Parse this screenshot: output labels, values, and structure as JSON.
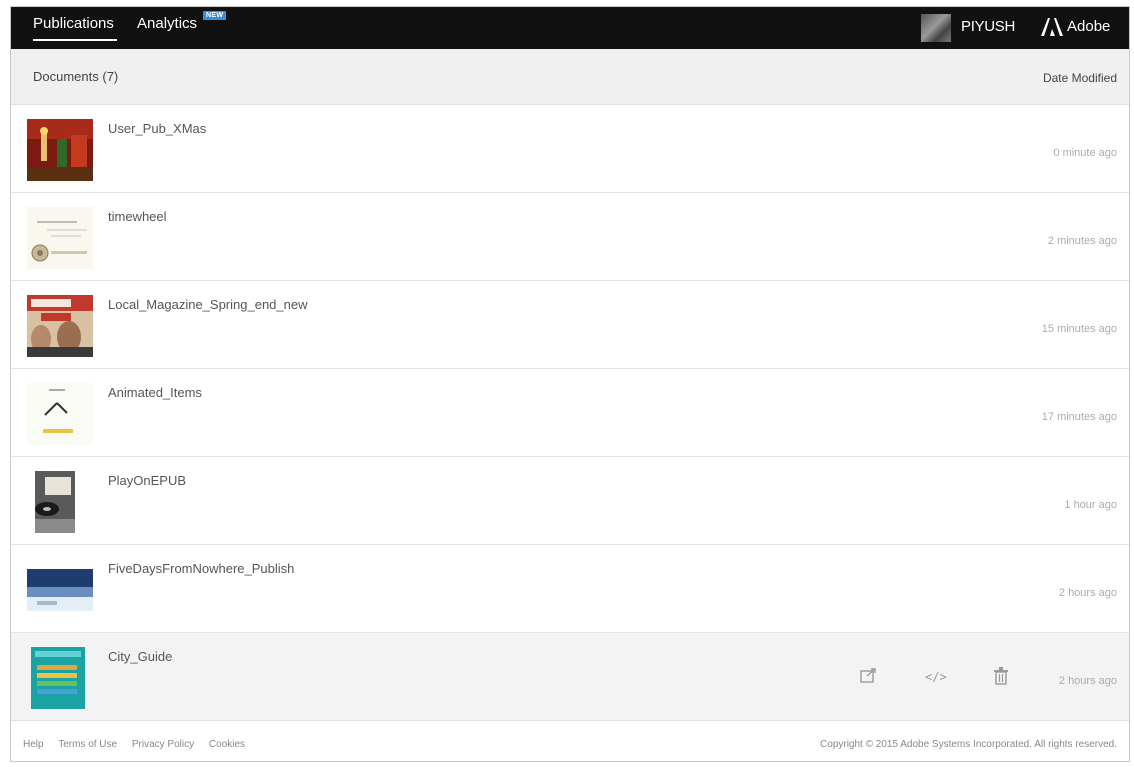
{
  "topbar": {
    "tabs": [
      {
        "label": "Publications"
      },
      {
        "label": "Analytics"
      }
    ],
    "new_badge": "NEW",
    "username": "PIYUSH",
    "brand": "Adobe"
  },
  "list": {
    "title": "Documents (7)",
    "sort_label": "Date Modified",
    "items": [
      {
        "name": "User_Pub_XMas",
        "modified": "0 minute ago"
      },
      {
        "name": "timewheel",
        "modified": "2 minutes ago"
      },
      {
        "name": "Local_Magazine_Spring_end_new",
        "modified": "15 minutes ago"
      },
      {
        "name": "Animated_Items",
        "modified": "17 minutes ago"
      },
      {
        "name": "PlayOnEPUB",
        "modified": "1 hour ago"
      },
      {
        "name": "FiveDaysFromNowhere_Publish",
        "modified": "2 hours ago"
      },
      {
        "name": "City_Guide",
        "modified": "2 hours ago"
      }
    ],
    "row_action_icons": [
      "share-icon",
      "embed-code-icon",
      "trash-icon"
    ]
  },
  "footer": {
    "links": [
      "Help",
      "Terms of Use",
      "Privacy Policy",
      "Cookies"
    ],
    "copyright": "Copyright © 2015 Adobe Systems Incorporated. All rights reserved."
  },
  "colors": {
    "topbar_bg": "#111111",
    "header_bg": "#f0f0f0",
    "badge_blue": "#3a8fd9",
    "hover_row_bg": "#f3f3f3"
  }
}
